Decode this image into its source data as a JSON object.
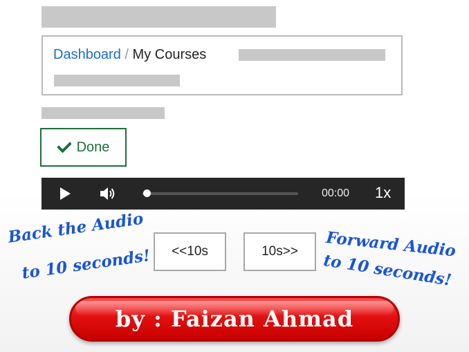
{
  "breadcrumb": {
    "dashboard": "Dashboard",
    "separator": "/",
    "current": "My Courses"
  },
  "done_button": {
    "icon": "check-icon",
    "label": "Done",
    "color": "#1e6e3c"
  },
  "audio_player": {
    "play_icon": "play-icon",
    "volume_icon": "volume-icon",
    "progress": 0.03,
    "time": "00:00",
    "speed": "1x"
  },
  "skip_buttons": {
    "back_label": "<<10s",
    "forward_label": "10s>>"
  },
  "annotations": {
    "back_line1": "Back the Audio",
    "back_line2": "to 10 seconds!",
    "forward_line1": "Forward Audio",
    "forward_line2": "to 10 seconds!"
  },
  "author_banner": {
    "text": "by : Faizan Ahmad",
    "color": "#e31010"
  }
}
